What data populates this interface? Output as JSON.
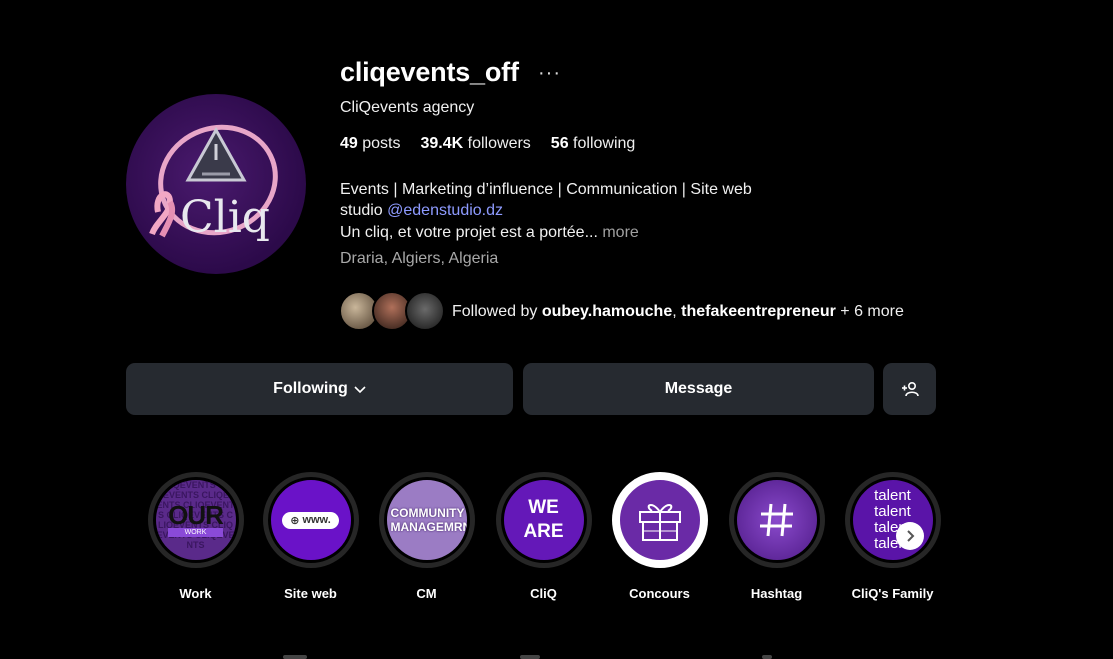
{
  "profile": {
    "username": "cliqevents_off",
    "more_icon": "···",
    "full_name": "CliQevents agency",
    "stats": {
      "posts_count": "49",
      "posts_label": "posts",
      "followers_count": "39.4K",
      "followers_label": "followers",
      "following_count": "56",
      "following_label": "following"
    },
    "bio": {
      "line1": "Events | Marketing d’influence | Communication | Site web",
      "line2_prefix": "studio ",
      "line2_link": "@edenstudio.dz",
      "line3": "Un cliq, et votre projet est a portée...",
      "more": " more"
    },
    "location": "Draria, Algiers, Algeria",
    "followed_by": {
      "prefix": "Followed by ",
      "user1": "oubey.hamouche",
      "sep": ", ",
      "user2": "thefakeentrepreneur",
      "suffix": " + 6 more"
    },
    "avatar_logo_text": "Cliq"
  },
  "actions": {
    "following_label": "Following",
    "message_label": "Message",
    "add_user_icon": "person-add-icon"
  },
  "highlights": [
    {
      "label": "Work",
      "cover_text": "OUR",
      "cover_subtext": "WORK"
    },
    {
      "label": "Site web",
      "cover_text": "www."
    },
    {
      "label": "CM",
      "cover_text": "COMMUNITY MANAGEMRNT"
    },
    {
      "label": "CliQ",
      "cover_text": "WE ARE"
    },
    {
      "label": "Concours",
      "cover_icon": "gift-icon"
    },
    {
      "label": "Hashtag",
      "cover_icon": "hashtag-icon"
    },
    {
      "label": "CliQ's Family",
      "cover_text": "talent"
    }
  ],
  "colors": {
    "background": "#000000",
    "button": "#262a30",
    "link": "#8e9bff",
    "muted": "#a8a8a8",
    "highlight_purple": "#6a1fc2"
  }
}
